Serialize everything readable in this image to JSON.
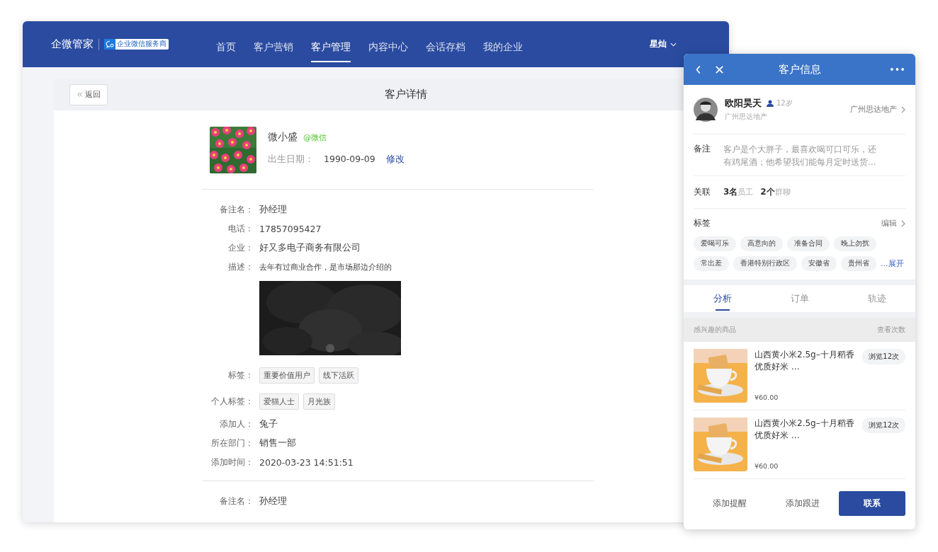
{
  "nav": {
    "brand": "企微管家",
    "badge": "企业微信服务商",
    "user": "星灿",
    "items": [
      {
        "label": "首页",
        "selected": false
      },
      {
        "label": "客户营销",
        "selected": false
      },
      {
        "label": "客户管理",
        "selected": true
      },
      {
        "label": "内容中心",
        "selected": false
      },
      {
        "label": "会话存档",
        "selected": false
      },
      {
        "label": "我的企业",
        "selected": false
      }
    ]
  },
  "page": {
    "back": "返回",
    "title": "客户详情"
  },
  "customer": {
    "name": "微小盛",
    "source": "@微信",
    "birth_label": "出生日期：",
    "birth": "1990-09-09",
    "edit": "修改"
  },
  "sections": [
    {
      "fields": [
        {
          "kind": "text",
          "label": "备注名：",
          "value": "孙经理"
        },
        {
          "kind": "text",
          "label": "电话：",
          "value": "17857095427"
        },
        {
          "kind": "text",
          "label": "企业：",
          "value": "好又多电子商务有限公司"
        },
        {
          "kind": "note",
          "label": "描述：",
          "value": "去年有过商业合作，是市场那边介绍的"
        },
        {
          "kind": "picture"
        },
        {
          "kind": "tags",
          "label": "标签：",
          "tags": [
            "重要价值用户",
            "线下活跃"
          ]
        },
        {
          "kind": "tags",
          "label": "个人标签：",
          "tags": [
            "爱猫人士",
            "月光族"
          ]
        },
        {
          "kind": "text",
          "label": "添加人：",
          "value": "兔子"
        },
        {
          "kind": "text",
          "label": "所在部门：",
          "value": "销售一部"
        },
        {
          "kind": "text",
          "label": "添加时间：",
          "value": "2020-03-23  14:51:51"
        }
      ]
    },
    {
      "fields": [
        {
          "kind": "text",
          "label": "备注名：",
          "value": "孙经理"
        }
      ]
    }
  ],
  "mobile": {
    "title": "客户信息",
    "profile": {
      "name": "欧阳昊天",
      "age": "12岁",
      "company": "广州思达地产",
      "link": "广州思达地产"
    },
    "note": {
      "label": "备注",
      "text": "客户是个大胖子，最喜欢喝可口可乐，还有鸡尾酒；他希望我们能每月定时送货…"
    },
    "relation": {
      "label": "关联",
      "items": [
        {
          "count": "3名",
          "unit": "员工"
        },
        {
          "count": "2个",
          "unit": "群聊"
        }
      ]
    },
    "tags": {
      "label": "标签",
      "edit": "编辑",
      "more": "…展开",
      "items": [
        "爱喝可乐",
        "高意向的",
        "准备合同",
        "晚上勿扰",
        "常出差",
        "香港特别行政区",
        "安徽省",
        "贵州省"
      ]
    },
    "tabs": [
      {
        "label": "分析",
        "selected": true
      },
      {
        "label": "订单",
        "selected": false
      },
      {
        "label": "轨迹",
        "selected": false
      }
    ],
    "products": {
      "header": "感兴趣的商品",
      "header_right": "查看次数",
      "items": [
        {
          "name": "山西黄小米2.5g–十月稻香优质好米 …",
          "views": "浏览12次",
          "price": "¥60.00"
        },
        {
          "name": "山西黄小米2.5g–十月稻香优质好米 …",
          "views": "浏览12次",
          "price": "¥60.00"
        }
      ]
    },
    "actions": [
      {
        "label": "添加提醒",
        "kind": "plain"
      },
      {
        "label": "添加跟进",
        "kind": "plain"
      },
      {
        "label": "联系",
        "kind": "primary"
      }
    ]
  }
}
